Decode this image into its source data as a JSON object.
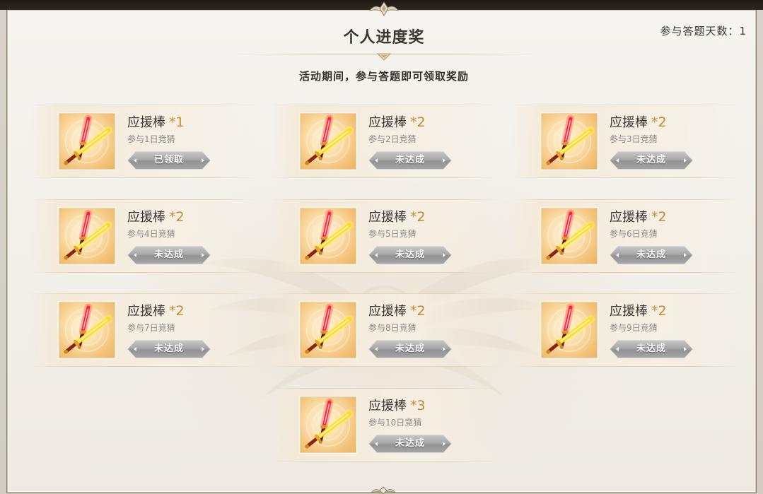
{
  "panel": {
    "title": "个人进度奖",
    "subtitle": "活动期间，参与答题即可领取奖励",
    "days_label": "参与答题天数：",
    "days_value": "1"
  },
  "rewards": [
    {
      "name": "应援棒",
      "quantity": "*1",
      "condition": "参与1日竞猜",
      "status": "已领取",
      "icon": "glow-stick-icon"
    },
    {
      "name": "应援棒",
      "quantity": "*2",
      "condition": "参与2日竞猜",
      "status": "未达成",
      "icon": "glow-stick-icon"
    },
    {
      "name": "应援棒",
      "quantity": "*2",
      "condition": "参与3日竞猜",
      "status": "未达成",
      "icon": "glow-stick-icon"
    },
    {
      "name": "应援棒",
      "quantity": "*2",
      "condition": "参与4日竞猜",
      "status": "未达成",
      "icon": "glow-stick-icon"
    },
    {
      "name": "应援棒",
      "quantity": "*2",
      "condition": "参与5日竞猜",
      "status": "未达成",
      "icon": "glow-stick-icon"
    },
    {
      "name": "应援棒",
      "quantity": "*2",
      "condition": "参与6日竞猜",
      "status": "未达成",
      "icon": "glow-stick-icon"
    },
    {
      "name": "应援棒",
      "quantity": "*2",
      "condition": "参与7日竞猜",
      "status": "未达成",
      "icon": "glow-stick-icon"
    },
    {
      "name": "应援棒",
      "quantity": "*2",
      "condition": "参与8日竞猜",
      "status": "未达成",
      "icon": "glow-stick-icon"
    },
    {
      "name": "应援棒",
      "quantity": "*2",
      "condition": "参与9日竞猜",
      "status": "未达成",
      "icon": "glow-stick-icon"
    },
    {
      "name": "应援棒",
      "quantity": "*3",
      "condition": "参与10日竞猜",
      "status": "未达成",
      "icon": "glow-stick-icon"
    }
  ],
  "colors": {
    "title_text": "#3b3632",
    "quantity_accent": "#c8892e",
    "condition_text": "#8d8a86",
    "button_face": "#a6a6a6",
    "button_text": "#ffffff",
    "panel_background": "#f2efe9"
  }
}
